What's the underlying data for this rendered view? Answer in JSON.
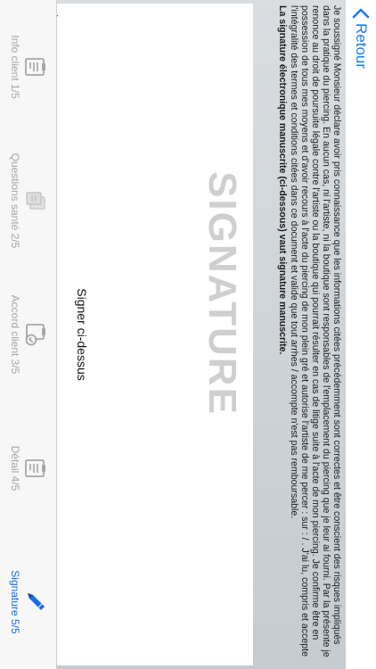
{
  "nav": {
    "back_label": "Retour"
  },
  "contract": {
    "body": "Je soussigné Monsieur   déclare avoir pris connaissance que les informations citées précédemment sont correctes et être conscient des risques impliqués dans la pratique du piercing. En aucun cas, ni l'artiste, ni la boutique sont responsables de l'emplacement du piercing que je leur ai fourni. Par la présente je renonce au droit de poursuite légale contre l'artiste ou la boutique qui pourrait résulter en cas de litige suite à l'acte de mon piercing. Je confirme être en possession de tous mes moyens et d'avoir recours à l'acte du piercing de mon plein gré et autorise l'artiste   de me percer :   sur :  / . J'ai lu, compris et accepte l'intégralité des termes et conditions citées dans ce document et valide que tout arrhes / accompte n'est pas remboursable.",
    "emphasis": "La signature électronique manuscrite (ci-dessous) vaut signature manuscrite."
  },
  "signature": {
    "watermark": "SIGNATURE",
    "prompt": "Signer ci-dessus"
  },
  "tabs": [
    {
      "label": "Info client 1/5",
      "icon": "clipboard-icon",
      "active": false
    },
    {
      "label": "Questions santé 2/5",
      "icon": "documents-icon",
      "active": false
    },
    {
      "label": "Accord client 3/5",
      "icon": "clipboard-check-icon",
      "active": false
    },
    {
      "label": "Détail 4/5",
      "icon": "clipboard-icon",
      "active": false
    },
    {
      "label": "Signature 5/5",
      "icon": "pen-icon",
      "active": true
    }
  ],
  "colors": {
    "accent": "#1b6ee0",
    "inactive": "#a6a6a6",
    "signature_line": "#2a3fb6"
  }
}
